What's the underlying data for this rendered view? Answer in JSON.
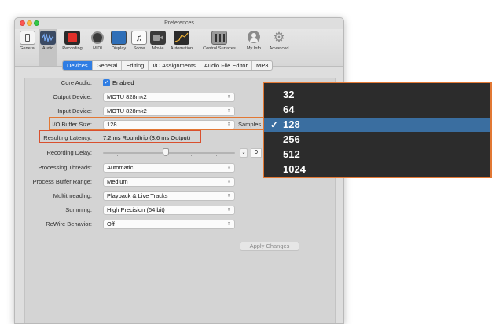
{
  "window": {
    "title": "Preferences"
  },
  "toolbar": {
    "items": [
      {
        "label": "General",
        "icon": "general-switch-icon"
      },
      {
        "label": "Audio",
        "icon": "audio-waveform-icon"
      },
      {
        "label": "Recording",
        "icon": "record-icon"
      },
      {
        "label": "MIDI",
        "icon": "midi-connector-icon"
      },
      {
        "label": "Display",
        "icon": "display-monitor-icon"
      },
      {
        "label": "Score",
        "icon": "score-notes-icon"
      },
      {
        "label": "Movie",
        "icon": "movie-camera-icon"
      },
      {
        "label": "Automation",
        "icon": "automation-curve-icon"
      },
      {
        "label": "Control Surfaces",
        "icon": "control-surfaces-icon"
      },
      {
        "label": "My Info",
        "icon": "user-icon"
      },
      {
        "label": "Advanced",
        "icon": "gear-icon"
      }
    ],
    "active": "Audio"
  },
  "tabs": [
    {
      "label": "Devices",
      "active": true
    },
    {
      "label": "General",
      "active": false
    },
    {
      "label": "Editing",
      "active": false
    },
    {
      "label": "I/O Assignments",
      "active": false
    },
    {
      "label": "Audio File Editor",
      "active": false
    },
    {
      "label": "MP3",
      "active": false
    }
  ],
  "settings": {
    "core_audio": {
      "label": "Core Audio:",
      "value": "Enabled",
      "checked": true
    },
    "output_device": {
      "label": "Output Device:",
      "value": "MOTU 828mk2"
    },
    "input_device": {
      "label": "Input Device:",
      "value": "MOTU 828mk2"
    },
    "io_buffer": {
      "label": "I/O Buffer Size:",
      "value": "128",
      "unit": "Samples"
    },
    "latency": {
      "label": "Resulting Latency:",
      "value": "7.2 ms Roundtrip (3.6 ms Output)"
    },
    "recording_delay": {
      "label": "Recording Delay:",
      "value": "0"
    },
    "processing_threads": {
      "label": "Processing Threads:",
      "value": "Automatic"
    },
    "process_buffer_range": {
      "label": "Process Buffer Range:",
      "value": "Medium"
    },
    "multithreading": {
      "label": "Multithreading:",
      "value": "Playback & Live Tracks"
    },
    "summing": {
      "label": "Summing:",
      "value": "High Precision (64 bit)"
    },
    "rewire": {
      "label": "ReWire Behavior:",
      "value": "Off"
    }
  },
  "apply_button": {
    "label": "Apply Changes",
    "enabled": false
  },
  "buffer_dropdown": {
    "options": [
      "32",
      "64",
      "128",
      "256",
      "512",
      "1024"
    ],
    "selected": "128",
    "check_glyph": "✓"
  },
  "colors": {
    "accent": "#2f7de3",
    "highlight_orange": "#e27834",
    "highlight_red": "#d9502e",
    "dropdown_bg": "#2c2c2c",
    "dropdown_selected": "#3a6ea0"
  }
}
